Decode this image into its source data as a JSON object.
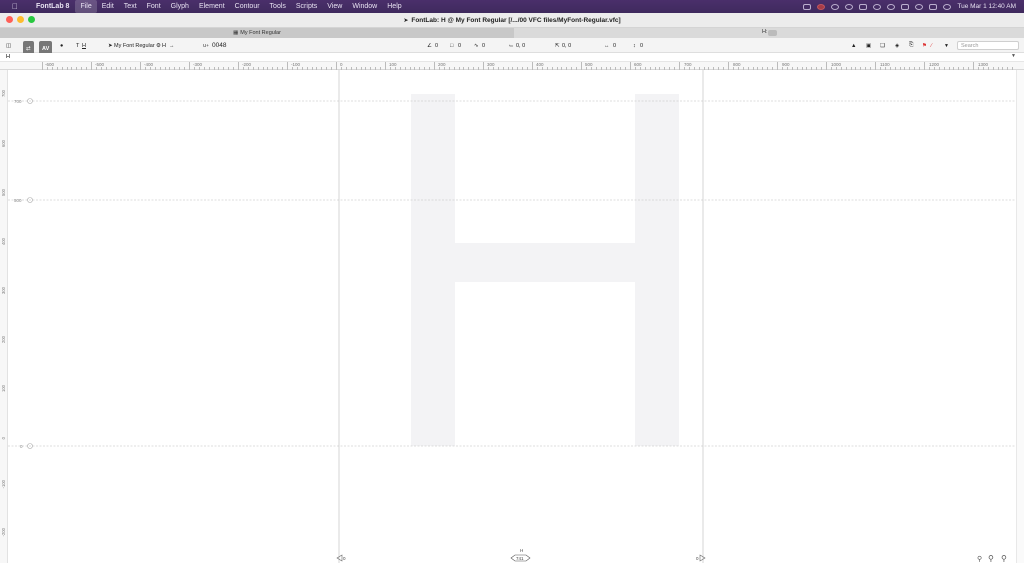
{
  "menubar": {
    "app_name": "FontLab 8",
    "items": [
      "File",
      "Edit",
      "Text",
      "Font",
      "Glyph",
      "Element",
      "Contour",
      "Tools",
      "Scripts",
      "View",
      "Window",
      "Help"
    ],
    "active_item": "File",
    "datetime": "Tue Mar 1  12:40 AM"
  },
  "window": {
    "title": "FontLab: H @ My Font Regular [/.../00 VFC files/MyFont-Regular.vfc]"
  },
  "tabbar": {
    "tab_label": "My Font Regular",
    "right_label": "H:"
  },
  "toolbar": {
    "glyph_label": "H",
    "font_label": "My Font Regular",
    "glyph_short": "H",
    "unicode_prefix": "U+",
    "unicode_value": "0048",
    "angle_value": "0",
    "nodes_value": "0",
    "contours_value": "0",
    "origin_value": "0, 0",
    "offset_value": "0, 0",
    "width_value": "0",
    "height_value": "0",
    "av_label": "AV",
    "search_placeholder": "Search"
  },
  "textbar": {
    "value": "H"
  },
  "ruler": {
    "h_labels": [
      "-600",
      "-500",
      "-400",
      "-300",
      "-200",
      "-100",
      "0",
      "100",
      "200",
      "300",
      "400",
      "500",
      "600",
      "700",
      "800",
      "900",
      "1000",
      "1100",
      "1200",
      "1300"
    ],
    "v_labels": [
      "700",
      "600",
      "500",
      "400",
      "300",
      "200",
      "100",
      "0",
      "-100",
      "-200"
    ]
  },
  "metrics": {
    "top_line_value": "700",
    "mid_line_value": "500",
    "baseline_value": "0",
    "left_sidebearing": "0",
    "right_sidebearing": "0",
    "glyph_name": "H",
    "advance_width": "741"
  },
  "colors": {
    "menubar_bg": "#3f2a5d",
    "glyph_fill": "#f3f3f5",
    "canvas_bg": "#ffffff"
  },
  "icons": [
    "apple-icon",
    "sidebar-toggle-icon",
    "kerning-icon",
    "lock-icon",
    "text-icon",
    "font-icon",
    "zoom-icons",
    "flag-icon",
    "search-icon"
  ]
}
